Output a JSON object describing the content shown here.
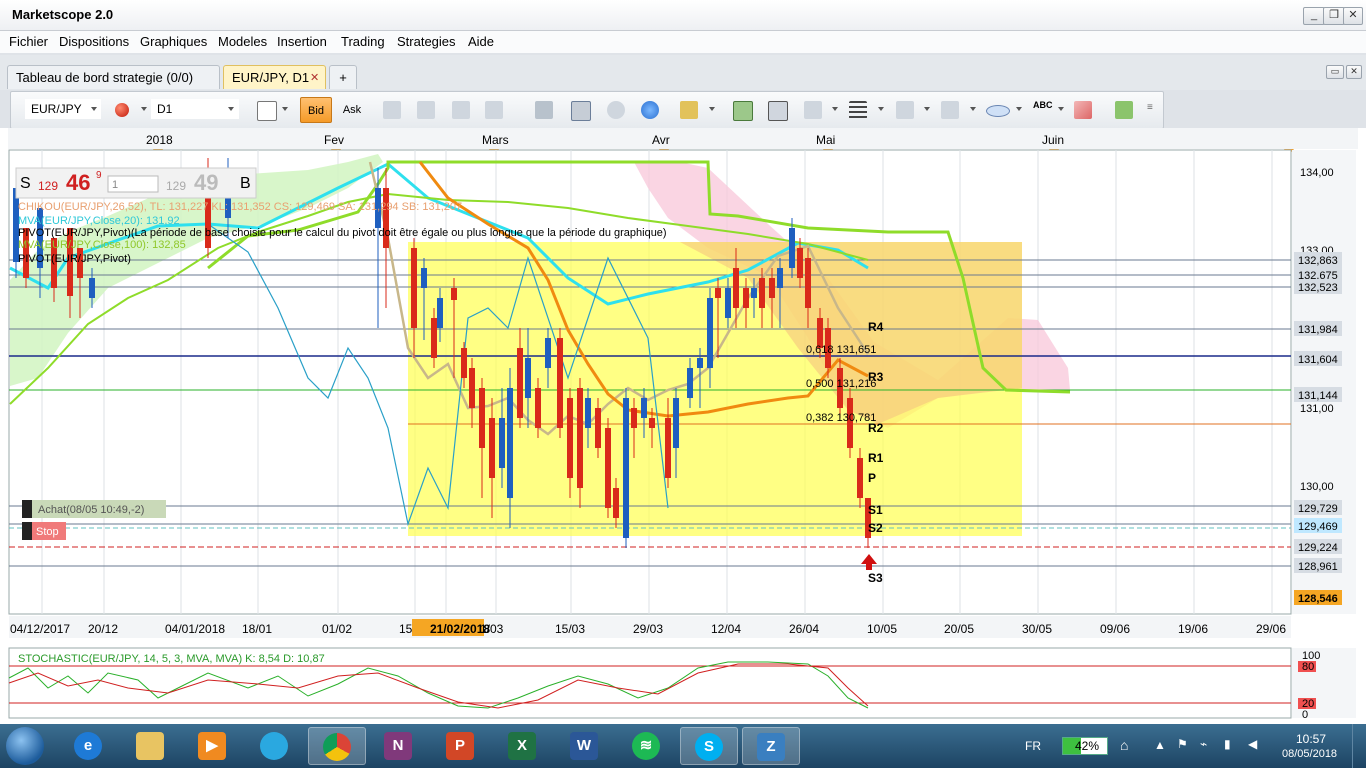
{
  "window": {
    "title": "Marketscope 2.0"
  },
  "menu": [
    "Fichier",
    "Dispositions",
    "Graphiques",
    "Modeles",
    "Insertion",
    "Trading",
    "Strategies",
    "Aide"
  ],
  "tabs": [
    {
      "label": "Tableau de bord strategie (0/0)",
      "active": false
    },
    {
      "label": "EUR/JPY, D1",
      "active": true,
      "close": "✕"
    }
  ],
  "tab_add": "+",
  "toolbar": {
    "symbol": "EUR/JPY",
    "timeframe": "D1",
    "bid_label": "Bid",
    "ask_label": "Ask",
    "abc_label": "ABC"
  },
  "chart": {
    "month_labels": [
      "2018",
      "Fev",
      "Mars",
      "Avr",
      "Mai",
      "Juin"
    ],
    "date_labels": [
      "04/12/2017",
      "20/12",
      "04/01/2018",
      "18/01",
      "01/02",
      "15",
      "21/02/2018",
      "1/03",
      "15/03",
      "29/03",
      "12/04",
      "26/04",
      "10/05",
      "20/05",
      "30/05",
      "09/06",
      "19/06",
      "29/06"
    ],
    "price_ticks": [
      "134,00",
      "133,00",
      "131,00",
      "130,00"
    ],
    "price_levels": [
      "132,863",
      "132,675",
      "132,523",
      "131,984",
      "131,604",
      "131,144",
      "129,729",
      "129,469",
      "129,224",
      "128,961",
      "128,546"
    ],
    "ticker": {
      "s_label": "S",
      "bid_big": "129",
      "bid_pips": "46",
      "bid_frac": "9",
      "qty": "1",
      "ask_big": "129",
      "ask_pips": "49",
      "b_label": "B"
    },
    "indicators": [
      "CHIKOU(EUR/JPY,26,52), TL: 131,227  KL: 131,352  CS: 129,469  SA: 131,294  SB: 131,207",
      "MVA(EUR/JPY,Close,20): 131,92",
      "PIVOT(EUR/JPY,Pivot)(La période de base choisie pour le calcul du pivot doit être égale ou plus longue que la période du graphique)",
      "MVA(EUR/JPY,Close,100): 132,85",
      "PIVOT(EUR/JPY,Pivot)"
    ],
    "fib_labels": [
      "0,618 131,651",
      "0,500 131,216",
      "0,382 130,781"
    ],
    "pivot_labels": [
      "R4",
      "R3",
      "R2",
      "R1",
      "P",
      "S1",
      "S2",
      "S3"
    ],
    "order_achat": "Achat(08/05 10:49,-2)",
    "order_stop": "Stop",
    "stochastic_label": "STOCHASTIC(EUR/JPY, 14, 5, 3, MVA, MVA)  K: 8,54  D: 10,87",
    "stoch_ticks": [
      "100",
      "80",
      "20",
      "0"
    ]
  },
  "taskbar": {
    "language": "FR",
    "battery": "42%",
    "time": "10:57",
    "date": "08/05/2018"
  },
  "colors": {
    "bull": "#1f5fbf",
    "bear": "#d92a1a",
    "ma_short": "#2ee0ee",
    "ma_long": "#8fdc2a",
    "kijun": "#f08a10"
  }
}
